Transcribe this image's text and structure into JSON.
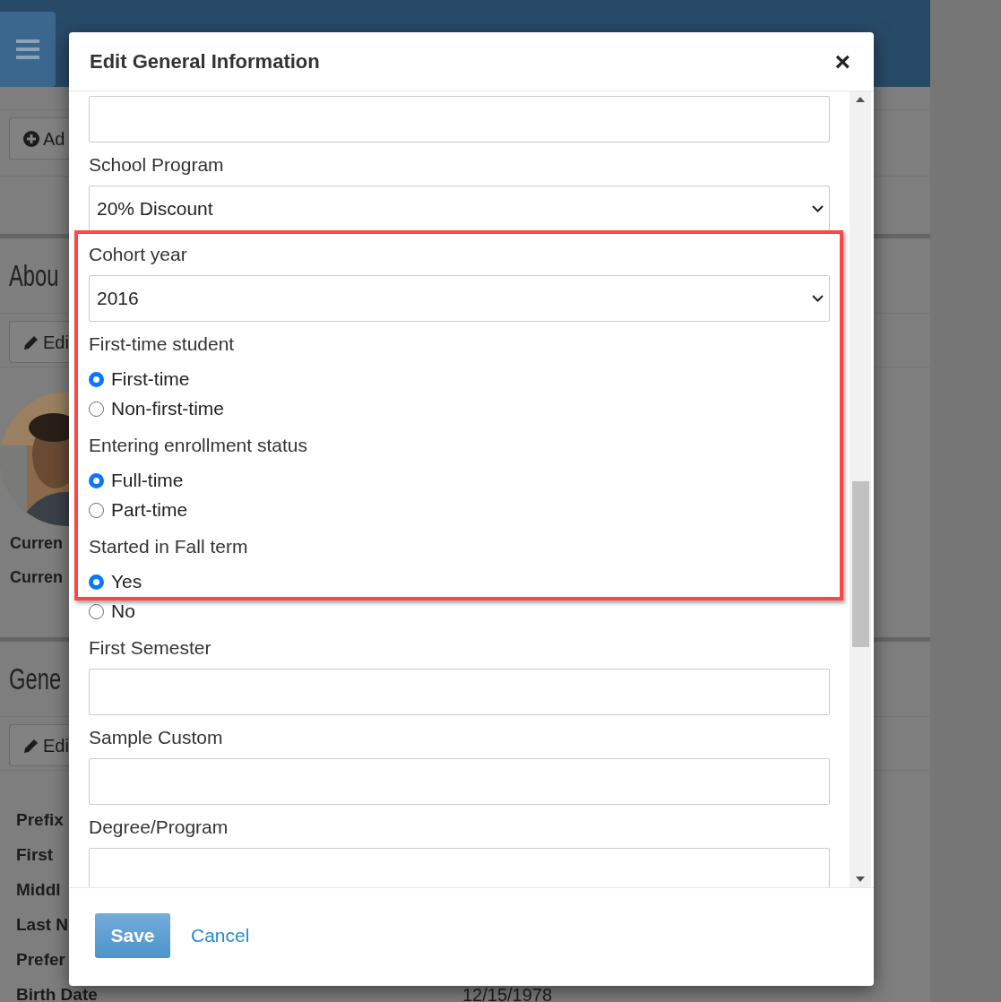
{
  "page": {
    "add_button": "Ad",
    "about_heading": "Abou",
    "about_edit_button": "Edi",
    "profile_labels": [
      "Curren",
      "Curren"
    ],
    "general_heading": "Gene",
    "general_edit_button": "Edi",
    "general_labels": [
      "Prefix",
      "First",
      "Middl",
      "Last N",
      "Prefer",
      "Birth Date"
    ],
    "birth_date_value": "12/15/1978"
  },
  "modal": {
    "title": "Edit General Information",
    "close": "×",
    "fields": [
      {
        "kind": "input"
      },
      {
        "kind": "select",
        "label": "School Program",
        "value": "20% Discount"
      },
      {
        "kind": "select",
        "label": "Cohort year",
        "value": "2016"
      },
      {
        "kind": "radio",
        "label": "First-time student",
        "options": [
          {
            "label": "First-time",
            "selected": true
          },
          {
            "label": "Non-first-time",
            "selected": false
          }
        ]
      },
      {
        "kind": "radio",
        "label": "Entering enrollment status",
        "options": [
          {
            "label": "Full-time",
            "selected": true
          },
          {
            "label": "Part-time",
            "selected": false
          }
        ]
      },
      {
        "kind": "radio",
        "label": "Started in Fall term",
        "options": [
          {
            "label": "Yes",
            "selected": true
          },
          {
            "label": "No",
            "selected": false
          }
        ]
      },
      {
        "kind": "input",
        "label": "First Semester"
      },
      {
        "kind": "input",
        "label": "Sample Custom"
      },
      {
        "kind": "input",
        "label": "Degree/Program"
      }
    ],
    "buttons": [
      {
        "kind": "primary",
        "label": "Save"
      },
      {
        "kind": "link",
        "label": "Cancel"
      }
    ]
  }
}
